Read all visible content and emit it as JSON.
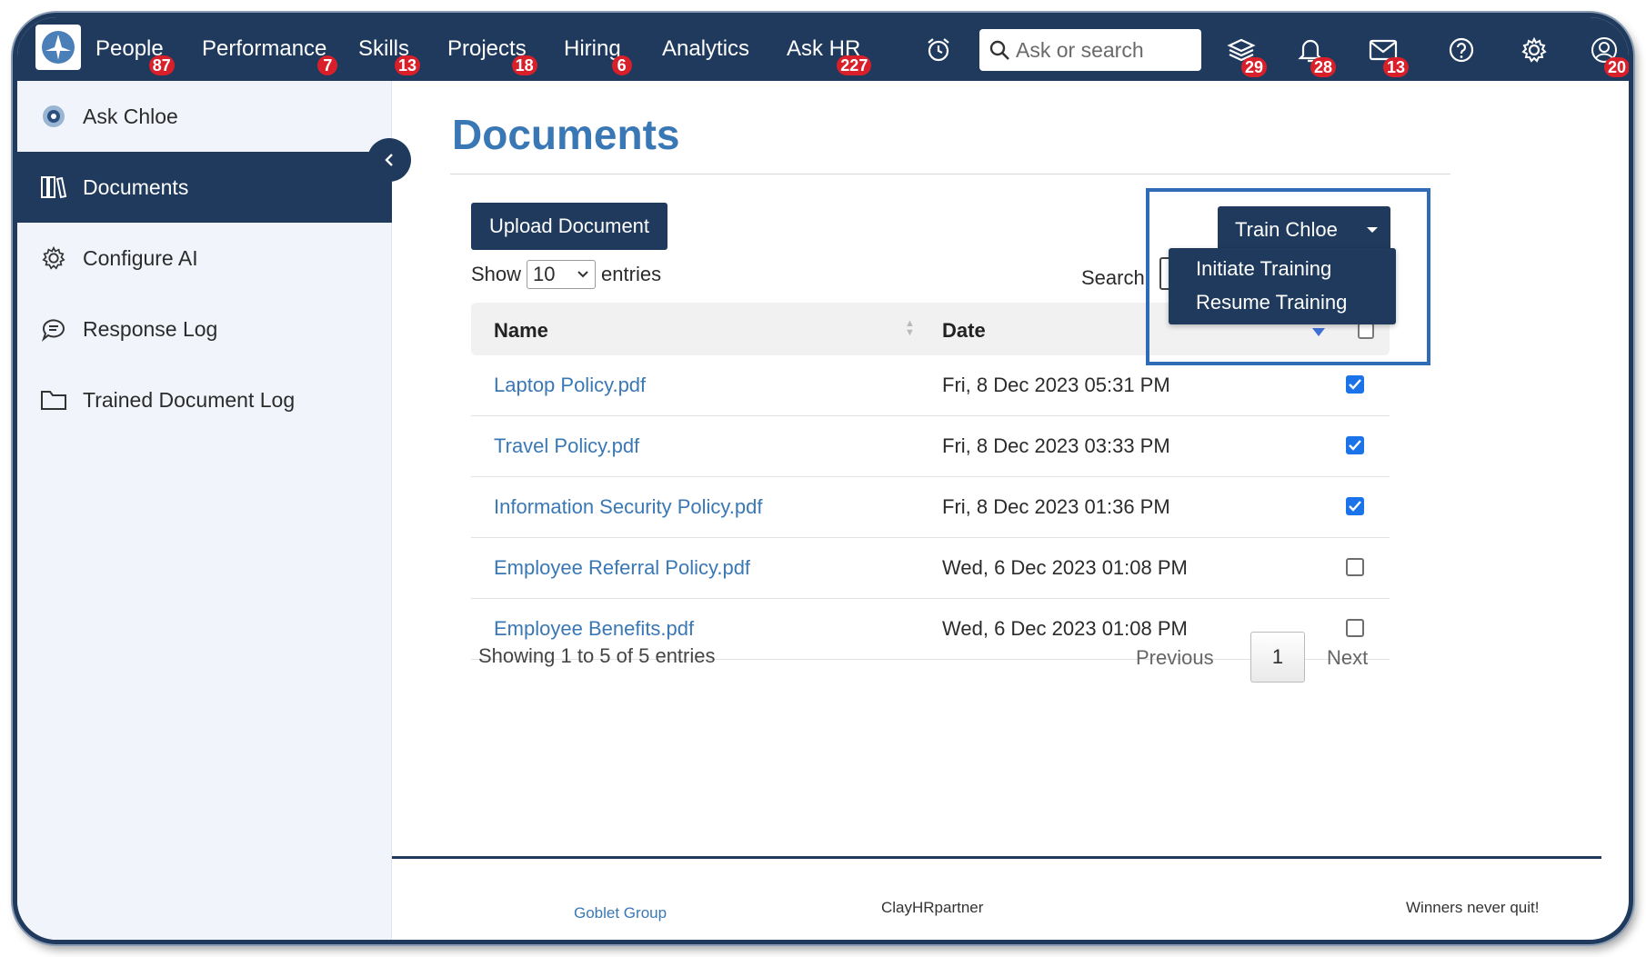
{
  "nav": {
    "items": [
      {
        "label": "People",
        "badge": "87"
      },
      {
        "label": "Performance",
        "badge": "7"
      },
      {
        "label": "Skills",
        "badge": "13"
      },
      {
        "label": "Projects",
        "badge": "18"
      },
      {
        "label": "Hiring",
        "badge": "6"
      },
      {
        "label": "Analytics",
        "badge": ""
      },
      {
        "label": "Ask HR",
        "badge": "227"
      }
    ],
    "search_placeholder": "Ask or search",
    "icon_badges": {
      "courses": "29",
      "notifications": "28",
      "messages": "13",
      "profile": "20"
    },
    "colors": {
      "bar": "#1f3a5c",
      "badge": "#d9202a"
    }
  },
  "sidebar": {
    "items": [
      {
        "label": "Ask Chloe",
        "icon": "chatbot-icon",
        "active": false
      },
      {
        "label": "Documents",
        "icon": "books-icon",
        "active": true
      },
      {
        "label": "Configure AI",
        "icon": "gear-icon",
        "active": false
      },
      {
        "label": "Response Log",
        "icon": "chat-bubble-icon",
        "active": false
      },
      {
        "label": "Trained Document Log",
        "icon": "folder-icon",
        "active": false
      }
    ]
  },
  "main": {
    "title": "Documents",
    "upload_label": "Upload Document",
    "show_label": "Show",
    "entries_value": "10",
    "entries_label": "entries",
    "search_label": "Search:",
    "train_label": "Train Chloe",
    "train_menu": [
      "Initiate Training",
      "Resume Training"
    ],
    "columns": {
      "name": "Name",
      "date": "Date"
    },
    "rows": [
      {
        "name": "Laptop Policy.pdf",
        "date": "Fri, 8 Dec 2023 05:31 PM",
        "checked": true
      },
      {
        "name": "Travel Policy.pdf",
        "date": "Fri, 8 Dec 2023 03:33 PM",
        "checked": true
      },
      {
        "name": "Information Security Policy.pdf",
        "date": "Fri, 8 Dec 2023 01:36 PM",
        "checked": true
      },
      {
        "name": "Employee Referral Policy.pdf",
        "date": "Wed, 6 Dec 2023 01:08 PM",
        "checked": false
      },
      {
        "name": "Employee Benefits.pdf",
        "date": "Wed, 6 Dec 2023 01:08 PM",
        "checked": false
      }
    ],
    "info": "Showing 1 to 5 of 5 entries",
    "pager": {
      "prev": "Previous",
      "page": "1",
      "next": "Next"
    }
  },
  "footer": {
    "left": "Goblet Group",
    "mid": "ClayHRpartner",
    "right": "Winners never quit!"
  }
}
